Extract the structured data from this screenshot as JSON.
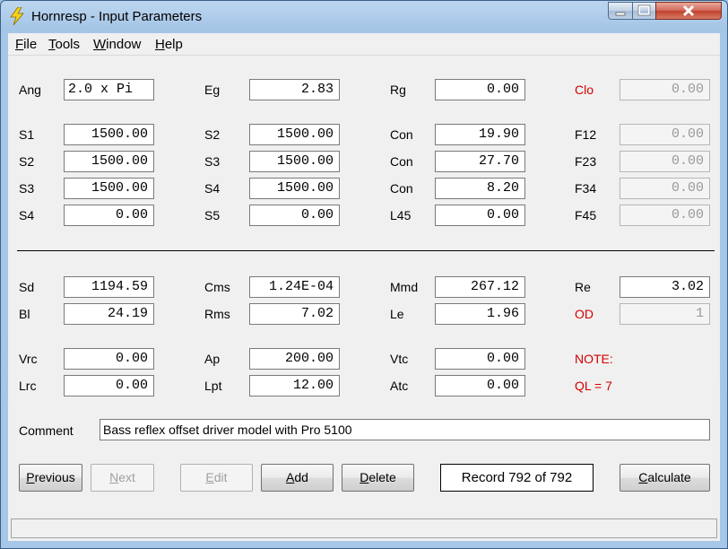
{
  "window": {
    "title": "Hornresp - Input Parameters"
  },
  "menu": {
    "file": "ile",
    "file_u": "F",
    "tools": "ools",
    "tools_u": "T",
    "window": "indow",
    "window_u": "W",
    "help": "elp",
    "help_u": "H"
  },
  "row1": {
    "ang_label": "Ang",
    "ang": "2.0 x Pi",
    "eg_label": "Eg",
    "eg": "2.83",
    "rg_label": "Rg",
    "rg": "0.00",
    "clo_label": "Clo",
    "clo": "0.00"
  },
  "row2": {
    "s1_label": "S1",
    "s1": "1500.00",
    "s2_label": "S2",
    "s2": "1500.00",
    "con_label": "Con",
    "con": "19.90",
    "f12_label": "F12",
    "f12": "0.00"
  },
  "row3": {
    "s2_label": "S2",
    "s2": "1500.00",
    "s3_label": "S3",
    "s3": "1500.00",
    "con_label": "Con",
    "con": "27.70",
    "f23_label": "F23",
    "f23": "0.00"
  },
  "row4": {
    "s3_label": "S3",
    "s3": "1500.00",
    "s4_label": "S4",
    "s4": "1500.00",
    "con_label": "Con",
    "con": "8.20",
    "f34_label": "F34",
    "f34": "0.00"
  },
  "row5": {
    "s4_label": "S4",
    "s4": "0.00",
    "s5_label": "S5",
    "s5": "0.00",
    "l45_label": "L45",
    "l45": "0.00",
    "f45_label": "F45",
    "f45": "0.00"
  },
  "driver": {
    "sd_label": "Sd",
    "sd": "1194.59",
    "cms_label": "Cms",
    "cms": "1.24E-04",
    "mmd_label": "Mmd",
    "mmd": "267.12",
    "re_label": "Re",
    "re": "3.02",
    "bl_label": "Bl",
    "bl": "24.19",
    "rms_label": "Rms",
    "rms": "7.02",
    "le_label": "Le",
    "le": "1.96",
    "od_label": "OD",
    "od": "1"
  },
  "chamber": {
    "vrc_label": "Vrc",
    "vrc": "0.00",
    "ap_label": "Ap",
    "ap": "200.00",
    "vtc_label": "Vtc",
    "vtc": "0.00",
    "note": "NOTE:",
    "lrc_label": "Lrc",
    "lrc": "0.00",
    "lpt_label": "Lpt",
    "lpt": "12.00",
    "atc_label": "Atc",
    "atc": "0.00",
    "ql": "QL = 7"
  },
  "comment": {
    "label": "Comment",
    "value": "Bass reflex offset driver model with Pro 5100"
  },
  "buttons": {
    "previous_u": "P",
    "previous": "revious",
    "next_u": "N",
    "next": "ext",
    "edit_u": "E",
    "edit": "dit",
    "add_u": "A",
    "add": "dd",
    "delete_u": "D",
    "delete": "elete",
    "calculate_u": "C",
    "calculate": "alculate"
  },
  "record": "Record 792 of 792",
  "colors": {
    "label_red": "#d40000",
    "titlebar": "#a7c7e8",
    "close": "#c1412c"
  }
}
